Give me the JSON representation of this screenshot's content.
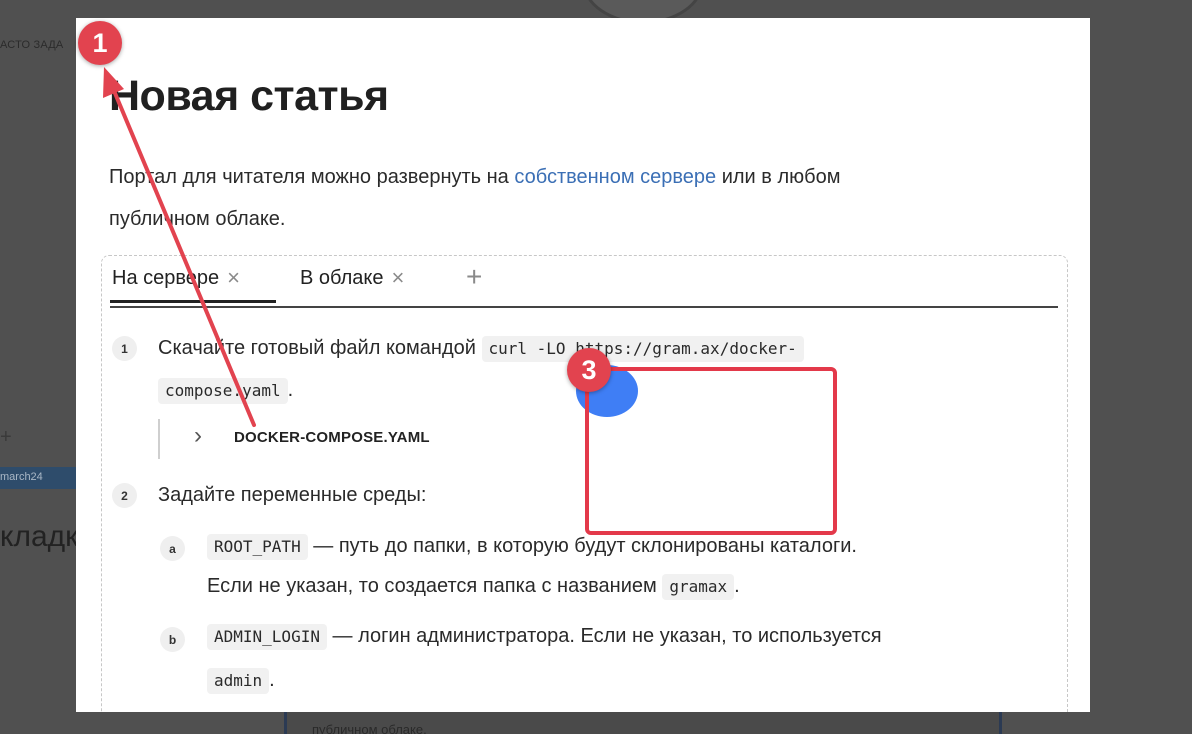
{
  "background": {
    "faq_label": "АСТО ЗАДА",
    "plus_glyph": "+",
    "branch_label": "march24",
    "bookmarks_label": "кладк",
    "snippet": "публичном облаке."
  },
  "article": {
    "title": "Новая статья",
    "intro_before_link": "Портал для читателя можно развернуть на ",
    "intro_link": "собственном сервере",
    "intro_after_link": " или в любом",
    "intro_line2": "публичном облаке."
  },
  "tabs": {
    "items": [
      {
        "label": "На сервере",
        "close": "×"
      },
      {
        "label": "В облаке",
        "close": "×"
      }
    ],
    "add_glyph": "+"
  },
  "steps": {
    "step1": {
      "num": "1",
      "text": "Скачайте готовый файл командой ",
      "code_part1": "curl -LO https://gram.ax/docker-",
      "code_part2": "compose.yaml",
      "after": "."
    },
    "file": {
      "chevron": "›",
      "name": "DOCKER-COMPOSE.YAML"
    },
    "step2": {
      "num": "2",
      "text": "Задайте переменные среды:"
    },
    "sub_a": {
      "letter": "a",
      "code": "ROOT_PATH",
      "text": " — путь до папки, в которую будут склонированы каталоги.",
      "line2": "Если не указан, то создается папка с названием ",
      "code2": "gramax",
      "after": "."
    },
    "sub_b": {
      "letter": "b",
      "code": "ADMIN_LOGIN",
      "text": " — логин администратора. Если не указан, то используется",
      "code2": "admin",
      "after": "."
    }
  },
  "annotations": {
    "marker1": "1",
    "marker3": "3",
    "accent_red": "#e2434f",
    "accent_blue": "#3f7ef5",
    "link_color": "#3b6fb5"
  }
}
